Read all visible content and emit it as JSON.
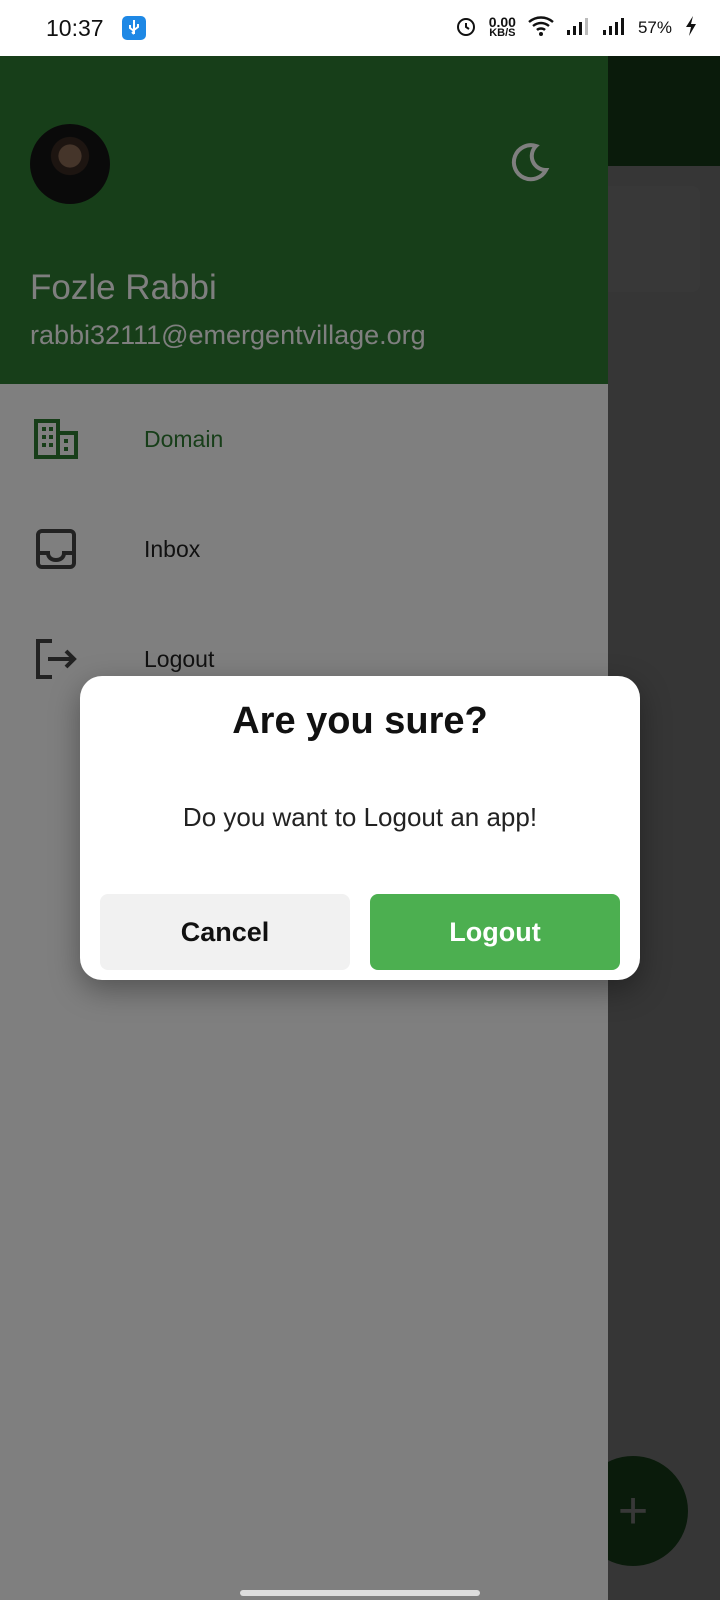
{
  "status_bar": {
    "time": "10:37",
    "usb_icon": "usb-icon",
    "net_speed_value": "0.00",
    "net_speed_unit": "KB/S",
    "battery": "57%",
    "icons": [
      "alarm-icon",
      "wifi-icon",
      "signal-icon",
      "signal-icon",
      "charging-icon"
    ]
  },
  "drawer": {
    "user_name": "Fozle Rabbi",
    "user_email": "rabbi32111@emergentvillage.org",
    "theme_icon": "moon-icon",
    "items": [
      {
        "label": "Domain",
        "icon": "building-icon",
        "active": true
      },
      {
        "label": "Inbox",
        "icon": "inbox-icon",
        "active": false
      },
      {
        "label": "Logout",
        "icon": "logout-icon",
        "active": false
      }
    ]
  },
  "dialog": {
    "title": "Are you sure?",
    "message": "Do you want to Logout an app!",
    "cancel_label": "Cancel",
    "confirm_label": "Logout"
  },
  "fab": {
    "label": "+"
  },
  "colors": {
    "primary": "#2e7d32",
    "accent": "#4caf50",
    "dialog_bg": "#ffffff"
  }
}
